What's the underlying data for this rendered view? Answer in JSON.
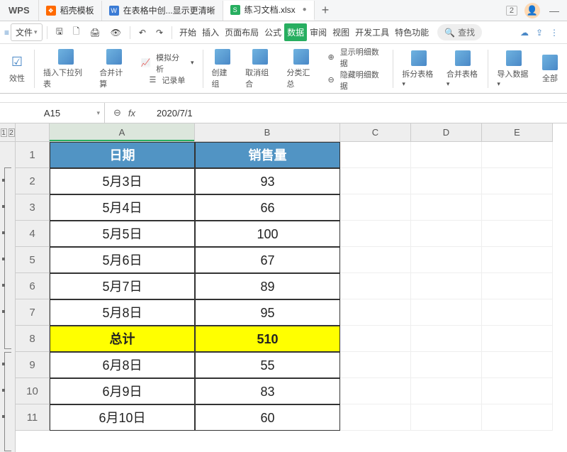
{
  "titlebar": {
    "logo": "WPS",
    "tabs": [
      {
        "icon": "orange",
        "iconText": "❖",
        "label": "稻壳模板"
      },
      {
        "icon": "blue",
        "iconText": "W",
        "label": "在表格中创...显示更清晰"
      },
      {
        "icon": "green",
        "iconText": "S",
        "label": "练习文档.xlsx"
      }
    ],
    "add": "+",
    "indicator": "2",
    "minimize": "—"
  },
  "menu": {
    "file": "文件",
    "quick": [
      "⎌",
      "↷",
      "▢",
      "🖨",
      "⧉",
      "⇄"
    ],
    "tabs": [
      "开始",
      "插入",
      "页面布局",
      "公式",
      "数据",
      "审阅",
      "视图",
      "开发工具",
      "特色功能"
    ],
    "activeTab": 4,
    "search": "查找",
    "searchIcon": "🔍"
  },
  "ribbon": {
    "g0a": {
      "label": "效性",
      "icon": "☑"
    },
    "g1": {
      "label": "插入下拉列表",
      "icon": "▥"
    },
    "g2": {
      "label": "合并计算",
      "icon": "⊞"
    },
    "g3a": {
      "label": "模拟分析",
      "icon": "📊"
    },
    "g3b": {
      "label": "记录单",
      "icon": "☰"
    },
    "g4": {
      "label": "创建组",
      "icon": "⊞"
    },
    "g5": {
      "label": "取消组合",
      "icon": "⊟"
    },
    "g6": {
      "label": "分类汇总",
      "icon": "▤"
    },
    "g7a": {
      "label": "显示明细数据",
      "icon": "⊕"
    },
    "g7b": {
      "label": "隐藏明细数据",
      "icon": "⊖"
    },
    "g8": {
      "label": "拆分表格",
      "icon": "▦"
    },
    "g9": {
      "label": "合并表格",
      "icon": "⊞"
    },
    "g10": {
      "label": "导入数据",
      "icon": "⬇"
    },
    "g11": {
      "label": "全部"
    }
  },
  "formulabar": {
    "namebox": "A15",
    "fx": "fx",
    "value": "2020/7/1",
    "zoomIcon": "⊖"
  },
  "sheet": {
    "outlineLevels": [
      "1",
      "2"
    ],
    "cols": [
      "A",
      "B",
      "C",
      "D",
      "E"
    ],
    "rows": [
      {
        "n": "1",
        "a": "日期",
        "b": "销售量",
        "cls": "hdr"
      },
      {
        "n": "2",
        "a": "5月3日",
        "b": "93"
      },
      {
        "n": "3",
        "a": "5月4日",
        "b": "66"
      },
      {
        "n": "4",
        "a": "5月5日",
        "b": "100"
      },
      {
        "n": "5",
        "a": "5月6日",
        "b": "67"
      },
      {
        "n": "6",
        "a": "5月7日",
        "b": "89"
      },
      {
        "n": "7",
        "a": "5月8日",
        "b": "95"
      },
      {
        "n": "8",
        "a": "总计",
        "b": "510",
        "cls": "total"
      },
      {
        "n": "9",
        "a": "6月8日",
        "b": "55"
      },
      {
        "n": "10",
        "a": "6月9日",
        "b": "83"
      },
      {
        "n": "11",
        "a": "6月10日",
        "b": "60"
      }
    ]
  }
}
